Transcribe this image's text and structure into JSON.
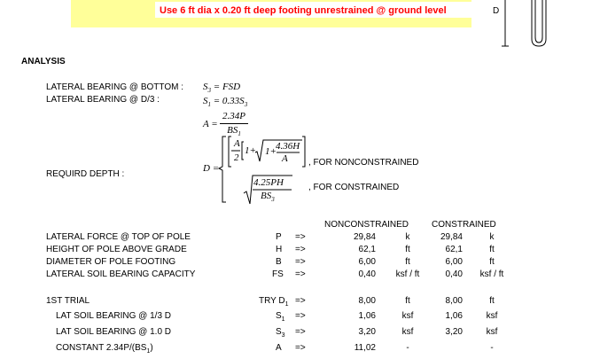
{
  "banner": "Use  6 ft dia x 0.20 ft  deep   footing unrestrained @ ground level",
  "diagram_label": "D",
  "section_title": "ANALYSIS",
  "formulas": {
    "lat_bottom_label": "LATERAL BEARING @ BOTTOM :",
    "lat_bottom_eq": "S3 = FSD",
    "lat_d3_label": "LATERAL BEARING @ D/3 :",
    "lat_d3_eq": "S1 = 0.33S3",
    "a_lhs": "A =",
    "a_num": "2.34P",
    "a_den": "BS1",
    "req_depth_label": "REQUIRD DEPTH :",
    "d_lhs": "D =",
    "nc_frac_num": "A",
    "nc_frac_den": "2",
    "nc_inner": "1+",
    "nc_sqrt_num": "4.36H",
    "nc_sqrt_den": "A",
    "nc_caption": ", FOR NONCONSTRAINED",
    "c_num": "4.25PH",
    "c_den": "BS3",
    "c_caption": ", FOR CONSTRAINED"
  },
  "headers": {
    "nonconstrained": "NONCONSTRAINED",
    "constrained": "CONSTRAINED"
  },
  "rows": [
    {
      "label": "LATERAL FORCE @ TOP OF POLE",
      "sym": "P",
      "arrow": "=>",
      "nc_val": "29,84",
      "nc_unit": "k",
      "c_val": "29,84",
      "c_unit": "k"
    },
    {
      "label": "HEIGHT OF POLE ABOVE GRADE",
      "sym": "H",
      "arrow": "=>",
      "nc_val": "62,1",
      "nc_unit": "ft",
      "c_val": "62,1",
      "c_unit": "ft"
    },
    {
      "label": "DIAMETER OF POLE FOOTING",
      "sym": "B",
      "arrow": "=>",
      "nc_val": "6,00",
      "nc_unit": "ft",
      "c_val": "6,00",
      "c_unit": "ft"
    },
    {
      "label": "LATERAL SOIL BEARING CAPACITY",
      "sym": "FS",
      "arrow": "=>",
      "nc_val": "0,40",
      "nc_unit": "ksf / ft",
      "c_val": "0,40",
      "c_unit": "ksf / ft"
    }
  ],
  "trial": [
    {
      "label": "1ST TRIAL",
      "sym": "TRY D1",
      "arrow": "=>",
      "nc_val": "8,00",
      "nc_unit": "ft",
      "c_val": "8,00",
      "c_unit": "ft"
    },
    {
      "label": "LAT SOIL BEARING @ 1/3 D",
      "sym": "S1",
      "arrow": "=>",
      "nc_val": "1,06",
      "nc_unit": "ksf",
      "c_val": "1,06",
      "c_unit": "ksf"
    },
    {
      "label": "LAT SOIL BEARING @ 1.0 D",
      "sym": "S3",
      "arrow": "=>",
      "nc_val": "3,20",
      "nc_unit": "ksf",
      "c_val": "3,20",
      "c_unit": "ksf"
    },
    {
      "label": "CONSTANT 2.34P/(BS1)",
      "sym": "A",
      "arrow": "=>",
      "nc_val": "11,02",
      "nc_unit": "-",
      "c_val": "",
      "c_unit": "-"
    }
  ]
}
